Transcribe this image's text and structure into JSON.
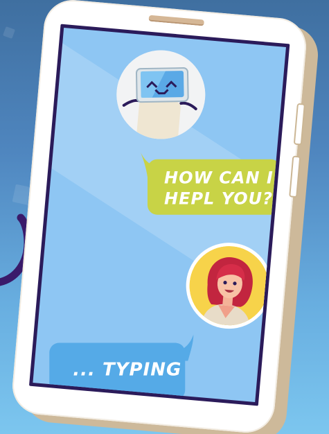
{
  "chat": {
    "bot_message": "HOW CAN I HEPL YOU?",
    "user_message": "... TYPING"
  },
  "colors": {
    "background_top": "#3f6fa0",
    "background_bottom": "#7cc6ef",
    "phone_body": "#ffffff",
    "phone_frame_shadow": "#cdb99a",
    "screen": "#8ec6f3",
    "screen_border": "#2b1b5a",
    "bot_bubble": "#c8d346",
    "user_bubble": "#55aae7",
    "user_avatar_bg": "#f7d34a",
    "bubble_text": "#ffffff",
    "cable": "#3a1a6a"
  },
  "icons": {
    "bot_avatar": "robot-face-icon",
    "user_avatar": "woman-avatar-icon",
    "cable": "cable-hook-icon"
  }
}
